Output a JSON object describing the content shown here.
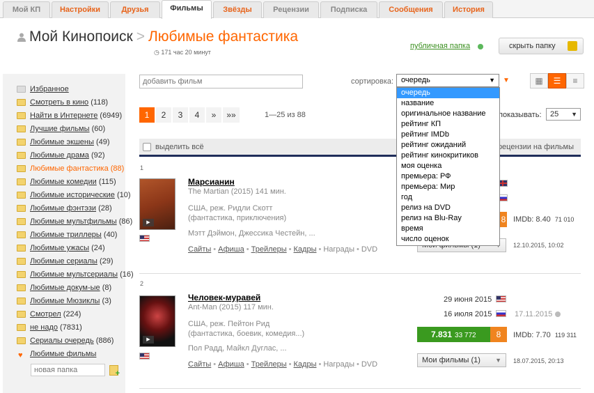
{
  "tabs": [
    {
      "label": "Мой КП",
      "style": "grey"
    },
    {
      "label": "Настройки",
      "style": "orange"
    },
    {
      "label": "Друзья",
      "style": "orange"
    },
    {
      "label": "Фильмы",
      "style": "active"
    },
    {
      "label": "Звёзды",
      "style": "orange"
    },
    {
      "label": "Рецензии",
      "style": "grey"
    },
    {
      "label": "Подписка",
      "style": "grey"
    },
    {
      "label": "Сообщения",
      "style": "orange"
    },
    {
      "label": "История",
      "style": "orange"
    }
  ],
  "header": {
    "root": "Мой Кинопоиск",
    "separator": ">",
    "folder": "Любимые фантастика",
    "duration": "171 час 20 минут",
    "public_folder": "публичная папка",
    "hide_folder": "скрыть папку"
  },
  "sidebar": {
    "items": [
      {
        "label": "Избранное",
        "count": "",
        "icon": "grey-folder"
      },
      {
        "label": "Смотреть в кино",
        "count": "(118)",
        "icon": "folder"
      },
      {
        "label": "Найти в Интернете",
        "count": "(6949)",
        "icon": "folder"
      },
      {
        "label": "Лучшие фильмы",
        "count": "(60)",
        "icon": "folder"
      },
      {
        "label": "Любимые экшены",
        "count": "(49)",
        "icon": "folder"
      },
      {
        "label": "Любимые драма",
        "count": "(92)",
        "icon": "folder"
      },
      {
        "label": "Любимые фантастика",
        "count": "(88)",
        "icon": "folder",
        "active": true
      },
      {
        "label": "Любимые комедии",
        "count": "(115)",
        "icon": "folder"
      },
      {
        "label": "Любимые исторические",
        "count": "(10)",
        "icon": "folder"
      },
      {
        "label": "Любимые фэнтэзи",
        "count": "(28)",
        "icon": "folder"
      },
      {
        "label": "Любимые мультфильмы",
        "count": "(86)",
        "icon": "folder"
      },
      {
        "label": "Любимые триллеры",
        "count": "(40)",
        "icon": "folder"
      },
      {
        "label": "Любимые ужасы",
        "count": "(24)",
        "icon": "folder"
      },
      {
        "label": "Любимые сериалы",
        "count": "(29)",
        "icon": "folder"
      },
      {
        "label": "Любимые мультсериалы",
        "count": "(16)",
        "icon": "folder"
      },
      {
        "label": "Любимые докум-ые",
        "count": "(8)",
        "icon": "folder"
      },
      {
        "label": "Любимые Мюзиклы",
        "count": "(3)",
        "icon": "folder"
      },
      {
        "label": "Смотрел",
        "count": "(224)",
        "icon": "folder"
      },
      {
        "label": "не надо",
        "count": "(7831)",
        "icon": "folder"
      },
      {
        "label": "Сериалы очередь",
        "count": "(886)",
        "icon": "folder"
      },
      {
        "label": "Любимые фильмы",
        "count": "",
        "icon": "heart"
      }
    ],
    "new_folder_placeholder": "новая папка"
  },
  "toolbar": {
    "add_film_placeholder": "добавить фильм",
    "sort_label": "сортировка:",
    "sort_value": "очередь",
    "sort_options": [
      "очередь",
      "название",
      "оригинальное название",
      "рейтинг КП",
      "рейтинг IMDb",
      "рейтинг ожиданий",
      "рейтинг кинокритиков",
      "моя оценка",
      "премьера: РФ",
      "премьера: Мир",
      "год",
      "релиз на DVD",
      "релиз на Blu-Ray",
      "время",
      "число оценок"
    ],
    "show_label": "показывать:",
    "per_page": "25"
  },
  "pagination": {
    "pages": [
      "1",
      "2",
      "3",
      "4",
      "»",
      "»»"
    ],
    "current": "1",
    "range": "1—25 из 88"
  },
  "list_header": {
    "select_all": "выделить всё",
    "reviews": "рецензии на фильмы"
  },
  "films": [
    {
      "num": "1",
      "title": "Марсианин",
      "original": "The Martian (2015) 141 мин.",
      "country_director": "США, реж. Ридли Скотт",
      "genres": "(фантастика, приключения)",
      "actors": "Мэтт Дэймон, Джессика Честейн, ...",
      "links": [
        "Сайты",
        "Афиша",
        "Трейлеры",
        "Кадры"
      ],
      "plain_links": [
        "Награды",
        "DVD"
      ],
      "kp_rating": "",
      "kp_votes": "",
      "my_rating": "8",
      "imdb_label": "IMDb: 8.40",
      "imdb_votes": "71 010",
      "folder_select": "Мои фильмы (1)",
      "added": "12.10.2015, 10:02"
    },
    {
      "num": "2",
      "title": "Человек-муравей",
      "original": "Ant-Man (2015) 117 мин.",
      "country_director": "США, реж. Пейтон Рид",
      "genres": "(фантастика, боевик, комедия...)",
      "actors": "Пол Радд, Майкл Дуглас, ...",
      "links": [
        "Сайты",
        "Афиша",
        "Трейлеры",
        "Кадры"
      ],
      "plain_links": [
        "Награды",
        "DVD"
      ],
      "world_premiere": "29 июня 2015",
      "ru_premiere": "16 июля 2015",
      "dvd_date": "17.11.2015",
      "kp_rating": "7.831",
      "kp_votes": "33 772",
      "my_rating": "8",
      "imdb_label": "IMDb: 7.70",
      "imdb_votes": "119 311",
      "folder_select": "Мои фильмы (1)",
      "added": "18.07.2015, 20:13"
    }
  ],
  "colors": {
    "accent": "#ff6600",
    "kp_green": "#3a9a1f",
    "list_border": "#1f2d5a"
  }
}
